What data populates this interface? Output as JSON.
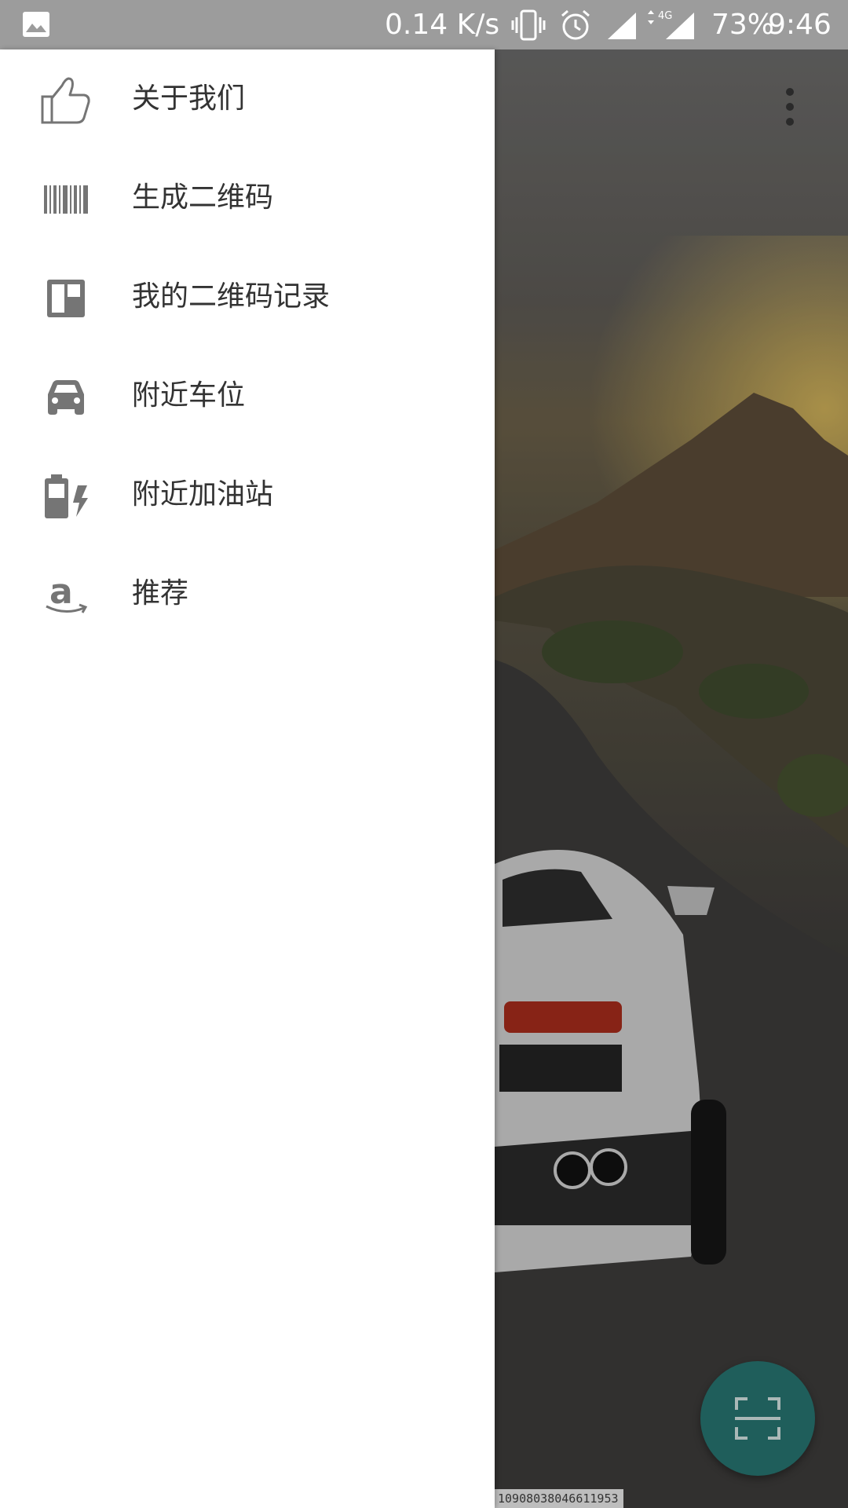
{
  "status_bar": {
    "net_speed": "0.14 K/s",
    "battery": "73%",
    "time": "9:46",
    "network_type": "4G",
    "icons": [
      "image-icon",
      "vibrate-icon",
      "alarm-icon",
      "signal-icon",
      "lte-signal-icon"
    ]
  },
  "drawer": {
    "items": [
      {
        "label": "关于我们",
        "icon": "thumbs-up-icon"
      },
      {
        "label": "生成二维码",
        "icon": "barcode-icon"
      },
      {
        "label": "我的二维码记录",
        "icon": "dashboard-icon"
      },
      {
        "label": "附近车位",
        "icon": "car-icon"
      },
      {
        "label": "附近加油站",
        "icon": "battery-charging-icon"
      },
      {
        "label": "推荐",
        "icon": "amazon-icon"
      }
    ]
  },
  "content": {
    "overflow_icon": "more-vert-icon",
    "fab_icon": "scan-icon",
    "bottom_code": "10908038046611953"
  },
  "colors": {
    "status_bar": "#9c9c9c",
    "drawer_bg": "#ffffff",
    "fab": "#1f5e5b",
    "text": "#333333",
    "icon": "#757575"
  }
}
